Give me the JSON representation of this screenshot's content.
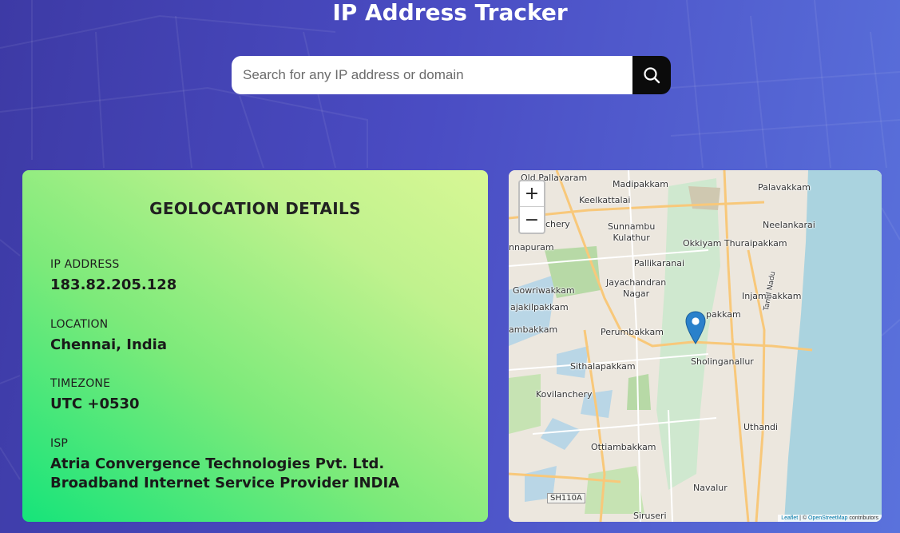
{
  "header": {
    "title": "IP Address Tracker"
  },
  "search": {
    "placeholder": "Search for any IP address or domain",
    "value": ""
  },
  "details": {
    "heading": "GEOLOCATION DETAILS",
    "ip_label": "IP ADDRESS",
    "ip_value": "183.82.205.128",
    "location_label": "LOCATION",
    "location_value": "Chennai, India",
    "timezone_label": "TIMEZONE",
    "timezone_value": "UTC +0530",
    "isp_label": "ISP",
    "isp_value": "Atria Convergence Technologies Pvt. Ltd. Broadband Internet Service Provider INDIA"
  },
  "map": {
    "zoom_in": "+",
    "zoom_out": "−",
    "attribution_leaflet": "Leaflet",
    "attribution_sep": " | © ",
    "attribution_osm": "OpenStreetMap",
    "attribution_tail": " contributors",
    "labels": {
      "old_pallavaram": "Old Pallavaram",
      "madipakkam": "Madipakkam",
      "palavakkam": "Palavakkam",
      "keelkattalai": "Keelkattalai",
      "chery": "chery",
      "sunnambu_kulathur": "Sunnambu\nKulathur",
      "neelankarai": "Neelankarai",
      "okkiyam": "Okkiyam Thuraipakkam",
      "nnapuram": "nnapuram",
      "pallikaranai": "Pallikaranai",
      "gowriwakkam": "Gowriwakkam",
      "jayachandran_nagar": "Jayachandran\nNagar",
      "injambakkam": "Injambakkam",
      "rajakilpakkam": "ajakilpakkam",
      "medavakkam_partial": "pakkam",
      "ambakkam": "ambakkam",
      "perumbakkam": "Perumbakkam",
      "sholinganallur": "Sholinganallur",
      "tamil_nadu": "Tamil Nadu",
      "sithalapakkam": "Sithalapakkam",
      "kovilanchery": "Kovilanchery",
      "uthandi": "Uthandi",
      "ottiambakkam": "Ottiambakkam",
      "navalur": "Navalur",
      "sh110a": "SH110A",
      "siruseri": "Siruseri"
    }
  },
  "colors": {
    "background_start": "#3d3aa5",
    "background_end": "#5a72dc",
    "card_green": "#16e47a",
    "card_lime": "#d8f795",
    "search_button": "#0b0b0b",
    "marker": "#2a81cb",
    "sea": "#aad3df"
  },
  "icons": {
    "search": "search-icon",
    "marker": "map-marker-icon"
  }
}
